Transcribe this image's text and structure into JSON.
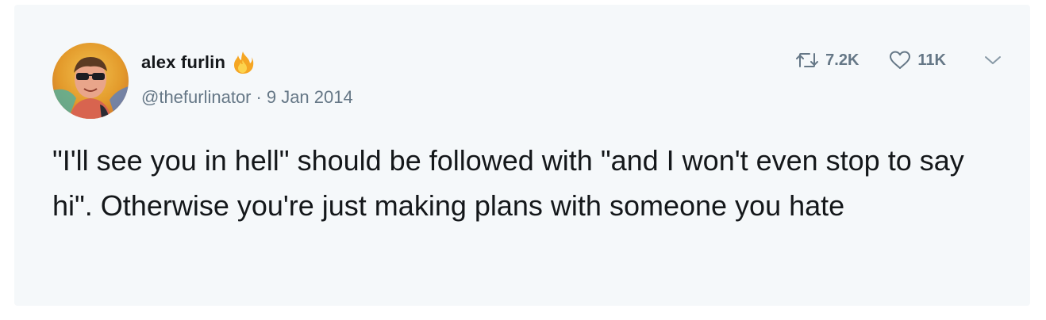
{
  "tweet": {
    "author": {
      "display_name": "alex furlin",
      "name_emoji": "fire-emoji",
      "handle": "@thefurlinator",
      "avatar": "avatar-photo"
    },
    "separator": "·",
    "date": "9 Jan 2014",
    "text": "\"I'll see you in hell\" should be followed with \"and I won't even stop to say hi\". Otherwise you're just making plans with someone you hate",
    "stats": {
      "retweets": "7.2K",
      "likes": "11K"
    },
    "icons": {
      "retweet": "retweet-icon",
      "like": "heart-icon",
      "menu": "chevron-down-icon"
    }
  },
  "colors": {
    "card_background": "#f5f8fa",
    "text_primary": "#14171a",
    "text_secondary": "#657786"
  }
}
